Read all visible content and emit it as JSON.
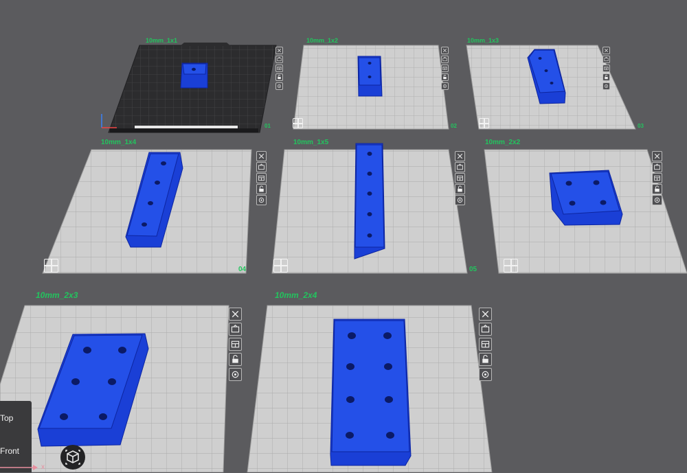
{
  "plates": [
    {
      "name": "10mm_1x1",
      "number": "01",
      "selected": true,
      "holes": 1
    },
    {
      "name": "10mm_1x2",
      "number": "02",
      "selected": false,
      "holes": 2
    },
    {
      "name": "10mm_1x3",
      "number": "03",
      "selected": false,
      "holes": 3
    },
    {
      "name": "10mm_1x4",
      "number": "04",
      "selected": false,
      "holes": 4
    },
    {
      "name": "10mm_1x5",
      "number": "05",
      "selected": false,
      "holes": 5
    },
    {
      "name": "10mm_2x2",
      "number": "",
      "selected": false,
      "holes": 4
    },
    {
      "name": "10mm_2x3",
      "number": "",
      "selected": false,
      "holes": 6
    },
    {
      "name": "10mm_2x4",
      "number": "",
      "selected": false,
      "holes": 8
    }
  ],
  "plate_toolbar_icons": [
    "close-icon",
    "arrange-icon",
    "orient-icon",
    "lock-icon",
    "settings-icon"
  ],
  "view_panel": {
    "top": "Top",
    "front": "Front"
  },
  "axis": {
    "x": "x"
  },
  "colors": {
    "background": "#5b5b5e",
    "plate": "#c9c9c9",
    "plate_selected": "#2f2f31",
    "part": "#1a3fd6",
    "label": "#22c55e"
  }
}
